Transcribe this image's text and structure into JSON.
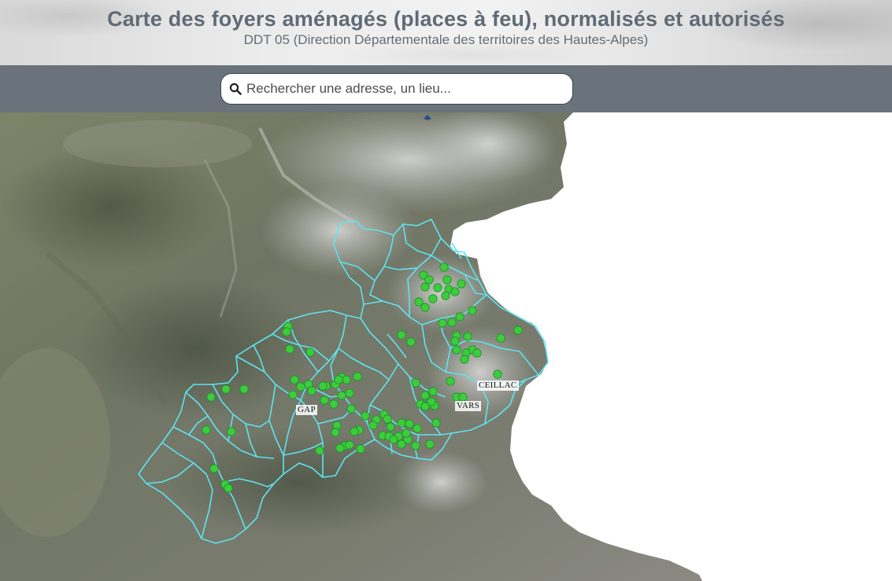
{
  "header": {
    "title": "Carte des foyers aménagés (places à feu), normalisés et autorisés",
    "subtitle": "DDT 05 (Direction Départementale des territoires des Hautes-Alpes)"
  },
  "search": {
    "placeholder": "Rechercher une adresse, un lieu...",
    "value": "",
    "icon": "search-icon"
  },
  "map": {
    "place_labels": [
      "GAP",
      "VARS",
      "CEILLAC"
    ],
    "colors": {
      "commune_boundaries": "#5fe3f0",
      "fire_pit_markers": "#3ccc3c",
      "marker_stroke": "#1f8f2a",
      "nodata": "#ffffff"
    },
    "icons": [
      "north-arrow-icon"
    ]
  }
}
